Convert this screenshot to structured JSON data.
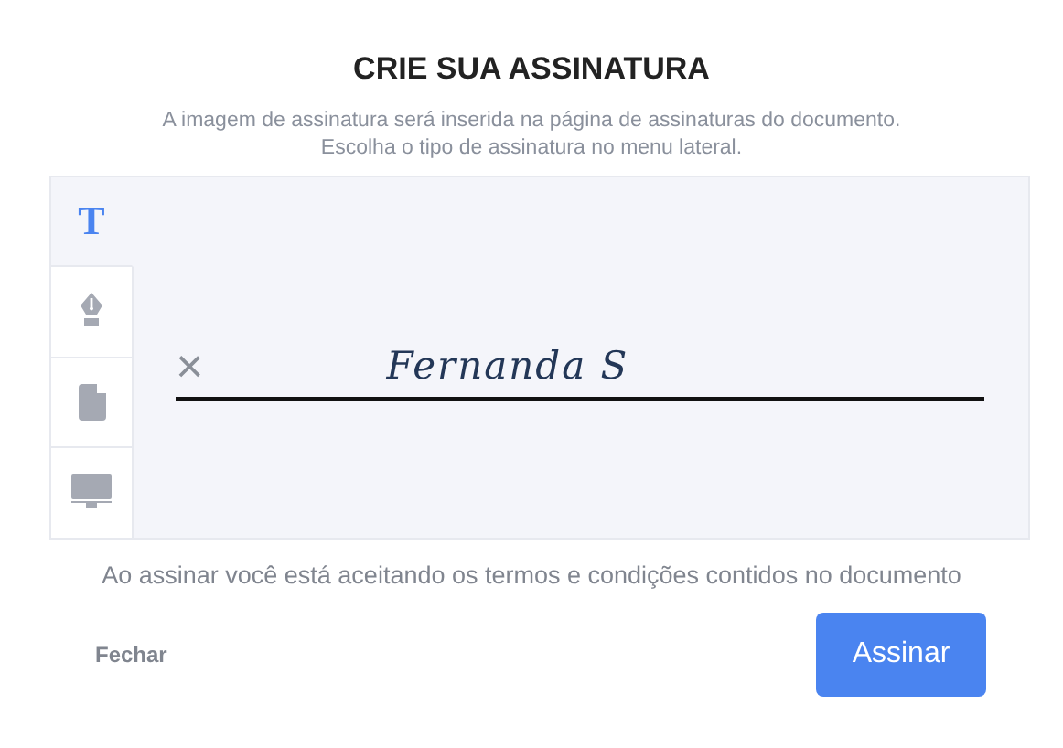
{
  "title": "CRIE SUA ASSINATURA",
  "subtitle": [
    "A imagem de assinatura será inserida na página de assinaturas do documento.",
    "Escolha o tipo de assinatura no menu lateral."
  ],
  "tabs": [
    {
      "kind": "text",
      "label": "T",
      "selected": true
    },
    {
      "kind": "draw",
      "selected": false
    },
    {
      "kind": "upload",
      "selected": false
    },
    {
      "kind": "screen",
      "selected": false
    }
  ],
  "clear_symbol": "×",
  "signature": "Fernanda S",
  "terms": "Ao assinar você está aceitando os termos e condições contidos no documento",
  "buttons": {
    "close": "Fechar",
    "sign": "Assinar"
  }
}
